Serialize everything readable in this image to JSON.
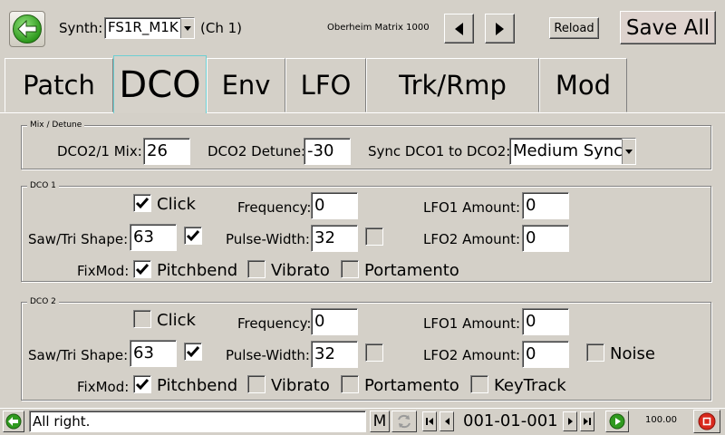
{
  "header": {
    "synth_label": "Synth:",
    "synth_value": "FS1R_M1K",
    "channel": "(Ch 1)",
    "device_name": "Oberheim Matrix 1000",
    "reload_label": "Reload",
    "save_all_label": "Save All"
  },
  "tabs": [
    {
      "label": "Patch",
      "active": false
    },
    {
      "label": "DCO",
      "active": true
    },
    {
      "label": "Env",
      "active": false
    },
    {
      "label": "LFO",
      "active": false
    },
    {
      "label": "Trk/Rmp",
      "active": false
    },
    {
      "label": "Mod",
      "active": false
    }
  ],
  "mix": {
    "title": "Mix / Detune",
    "mix_label": "DCO2/1 Mix:",
    "mix_value": "26",
    "detune_label": "DCO2 Detune:",
    "detune_value": "-30",
    "sync_label": "Sync DCO1 to DCO2:",
    "sync_value": "Medium Sync"
  },
  "dco1": {
    "title": "DCO 1",
    "click_label": "Click",
    "click_checked": true,
    "saw_tri_label": "Saw/Tri Shape:",
    "saw_tri_value": "63",
    "saw_tri_checked": true,
    "frequency_label": "Frequency:",
    "frequency_value": "0",
    "pulse_width_label": "Pulse-Width:",
    "pulse_width_value": "32",
    "pulse_checked": false,
    "lfo1_label": "LFO1 Amount:",
    "lfo1_value": "0",
    "lfo2_label": "LFO2 Amount:",
    "lfo2_value": "0",
    "fixmod_label": "FixMod:",
    "pitchbend_label": "Pitchbend",
    "pitchbend_checked": true,
    "vibrato_label": "Vibrato",
    "vibrato_checked": false,
    "portamento_label": "Portamento",
    "portamento_checked": false
  },
  "dco2": {
    "title": "DCO 2",
    "click_label": "Click",
    "click_checked": false,
    "saw_tri_label": "Saw/Tri Shape:",
    "saw_tri_value": "63",
    "saw_tri_checked": true,
    "frequency_label": "Frequency:",
    "frequency_value": "0",
    "pulse_width_label": "Pulse-Width:",
    "pulse_width_value": "32",
    "pulse_checked": false,
    "lfo1_label": "LFO1 Amount:",
    "lfo1_value": "0",
    "lfo2_label": "LFO2 Amount:",
    "lfo2_value": "0",
    "noise_label": "Noise",
    "noise_checked": false,
    "fixmod_label": "FixMod:",
    "pitchbend_label": "Pitchbend",
    "pitchbend_checked": true,
    "vibrato_label": "Vibrato",
    "vibrato_checked": false,
    "portamento_label": "Portamento",
    "portamento_checked": false,
    "keytrack_label": "KeyTrack",
    "keytrack_checked": false
  },
  "status": {
    "message": "All right.",
    "m_label": "M",
    "position": "001-01-001",
    "tempo": "100.00"
  },
  "colors": {
    "background": "#d4d0c8",
    "active_tab_border": "#6ccfd3",
    "go_green": "#2f9a1e",
    "stop_red": "#d9281c"
  }
}
